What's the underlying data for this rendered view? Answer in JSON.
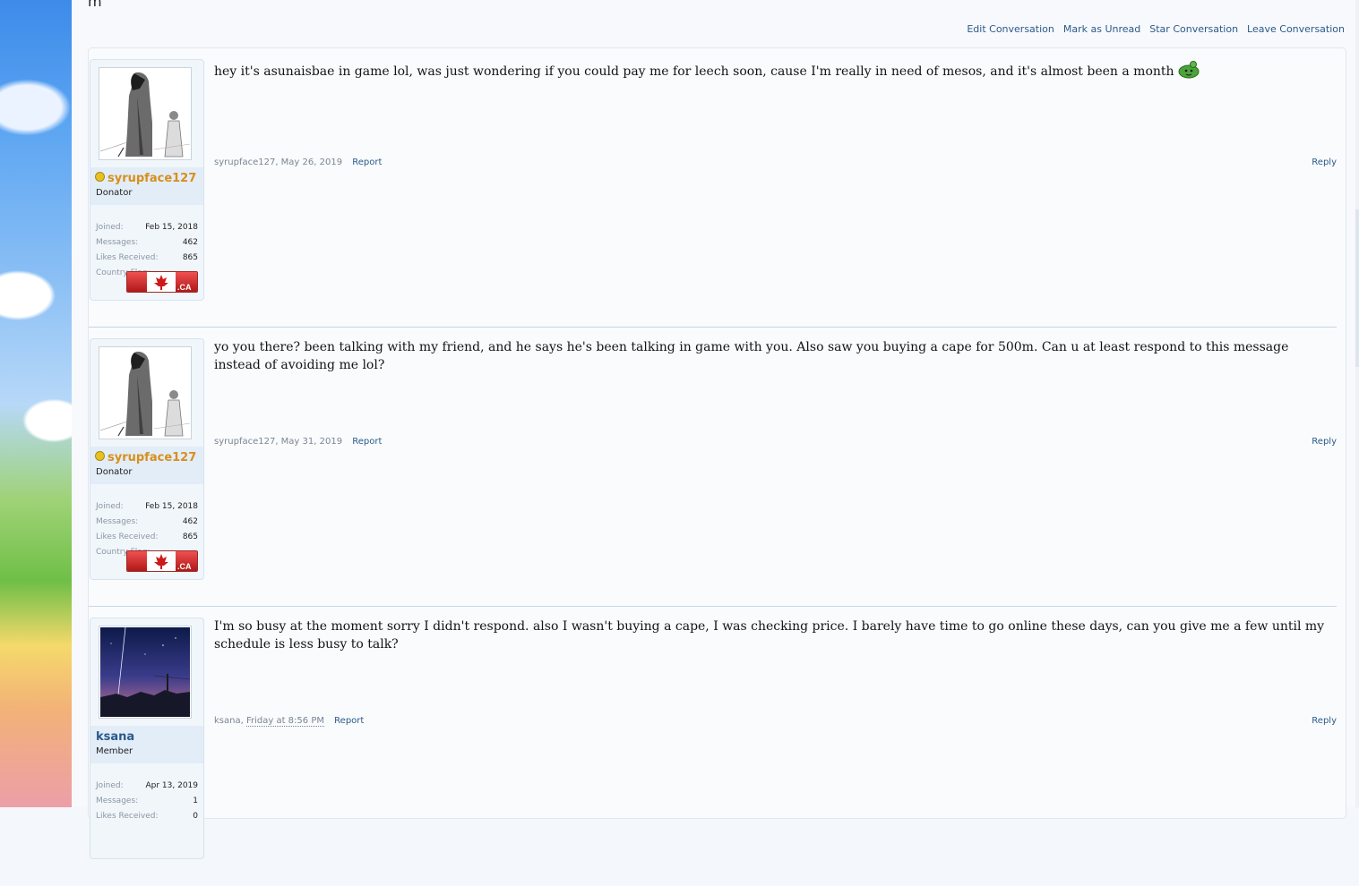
{
  "header": {
    "title_fragment": "m"
  },
  "conversation_actions": [
    "Edit Conversation",
    "Mark as Unread",
    "Star Conversation",
    "Leave Conversation"
  ],
  "messages": [
    {
      "author": "syrupface127",
      "user_title": "Donator",
      "online": true,
      "avatar": "anime-girl-sketch",
      "stats": [
        {
          "label": "Joined:",
          "value": "Feb 15, 2018"
        },
        {
          "label": "Messages:",
          "value": "462"
        },
        {
          "label": "Likes Received:",
          "value": "865"
        },
        {
          "label": "Country Flag:",
          "value": ""
        }
      ],
      "flag_label": ".CA",
      "text": "hey it's asunaisbae in game lol, was just wondering if you could pay me for leech soon, cause I'm really in need of mesos, and it's almost been a month",
      "smiley": "green-blob-smiley",
      "meta_author": "syrupface127",
      "date": "May 26, 2019",
      "report": "Report",
      "reply": "Reply"
    },
    {
      "author": "syrupface127",
      "user_title": "Donator",
      "online": true,
      "avatar": "anime-girl-sketch",
      "stats": [
        {
          "label": "Joined:",
          "value": "Feb 15, 2018"
        },
        {
          "label": "Messages:",
          "value": "462"
        },
        {
          "label": "Likes Received:",
          "value": "865"
        },
        {
          "label": "Country Flag:",
          "value": ""
        }
      ],
      "flag_label": ".CA",
      "text": "yo you there? been talking with my friend, and he says he's been talking in game with you. Also saw you buying a cape for 500m. Can u at least respond to this message instead of avoiding me lol?",
      "meta_author": "syrupface127",
      "date": "May 31, 2019",
      "report": "Report",
      "reply": "Reply"
    },
    {
      "author": "ksana",
      "user_title": "Member",
      "online": false,
      "avatar": "night-sky-scene",
      "stats": [
        {
          "label": "Joined:",
          "value": "Apr 13, 2019"
        },
        {
          "label": "Messages:",
          "value": "1"
        },
        {
          "label": "Likes Received:",
          "value": "0"
        }
      ],
      "text": "I'm so busy at the moment sorry I didn't respond. also I wasn't buying a cape, I was checking price. I barely have time to go online these days, can you give me a few until my schedule is less busy to talk?",
      "meta_author": "ksana",
      "date": "Friday at 8:56 PM",
      "report": "Report",
      "reply": "Reply"
    }
  ],
  "colors": {
    "link": "#2b5a8a",
    "donator_name": "#d88f1a",
    "user_panel": "#f1f6fb",
    "name_band": "#e2edf8",
    "separator": "#c7d6e6"
  }
}
